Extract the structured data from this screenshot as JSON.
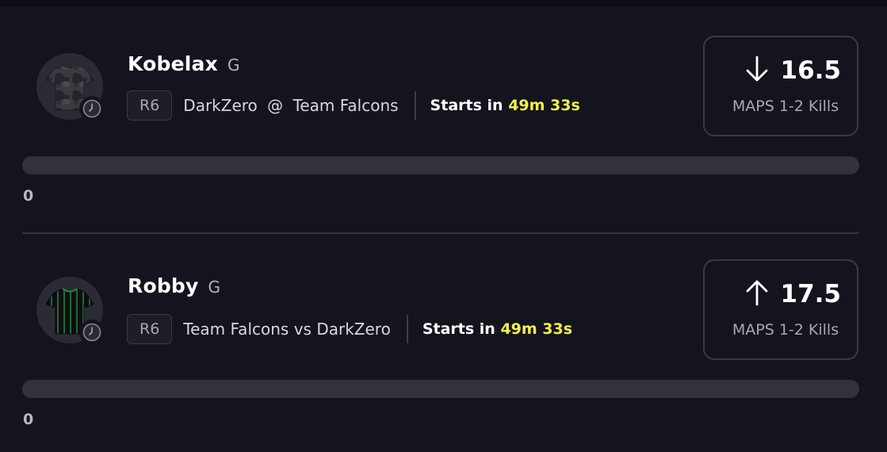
{
  "colors": {
    "background": "#14141e",
    "accent_time": "#f3f04a",
    "progress_track": "#32323d",
    "border": "#3a3a47"
  },
  "projections": [
    {
      "player_name": "Kobelax",
      "position": "G",
      "league": "R6",
      "team": "DarkZero",
      "connector": "@",
      "opponent": "Team Falcons",
      "starts_label": "Starts in",
      "starts_time": "49m 33s",
      "direction_icon": "arrow-down-icon",
      "line_value": "16.5",
      "stat_label": "MAPS 1-2 Kills",
      "progress_count": "0",
      "progress_fraction": 0,
      "jersey_icon": "jersey-camo-icon"
    },
    {
      "player_name": "Robby",
      "position": "G",
      "league": "R6",
      "team": "Team Falcons",
      "connector": "vs",
      "opponent": "DarkZero",
      "starts_label": "Starts in",
      "starts_time": "49m 33s",
      "direction_icon": "arrow-up-icon",
      "line_value": "17.5",
      "stat_label": "MAPS 1-2 Kills",
      "progress_count": "0",
      "progress_fraction": 0,
      "jersey_icon": "jersey-striped-icon"
    }
  ]
}
